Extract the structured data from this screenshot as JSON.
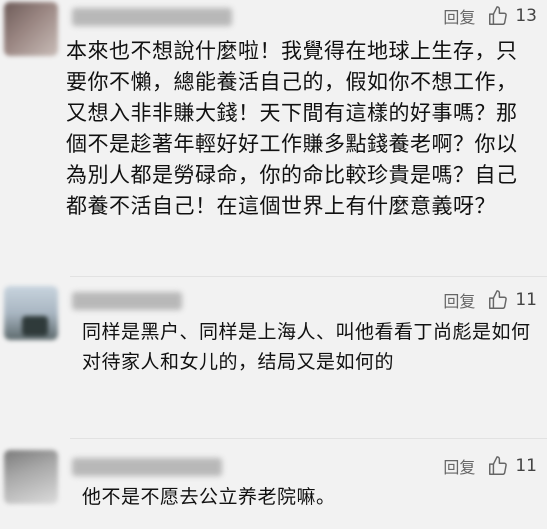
{
  "comments": [
    {
      "reply_label": "回复",
      "like_count": "13",
      "text": "本來也不想說什麼啦！我覺得在地球上生存，只要你不懶，總能養活自己的，假如你不想工作，又想入非非賺大錢！天下間有這樣的好事嗎？那個不是趁著年輕好好工作賺多點錢養老啊？你以為別人都是勞碌命，你的命比較珍貴是嗎？自己都養不活自己！在這個世界上有什麼意義呀？"
    },
    {
      "reply_label": "回复",
      "like_count": "11",
      "text": "同样是黑户、同样是上海人、叫他看看丁尚彪是如何对待家人和女儿的，结局又是如何的"
    },
    {
      "reply_label": "回复",
      "like_count": "11",
      "text": "他不是不愿去公立养老院嘛。"
    }
  ]
}
